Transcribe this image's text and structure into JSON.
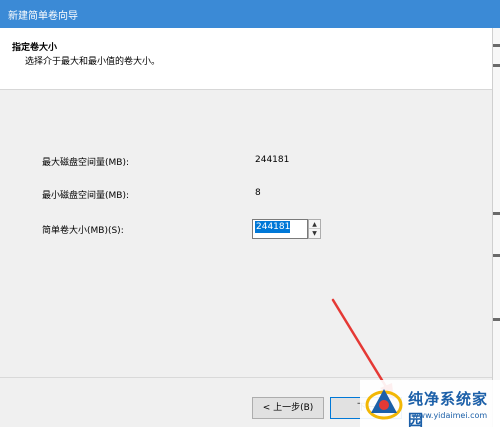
{
  "window": {
    "title": "新建简单卷向导"
  },
  "header": {
    "title": "指定卷大小",
    "subtitle": "选择介于最大和最小值的卷大小。"
  },
  "fields": [
    {
      "label": "最大磁盘空间量(MB):",
      "value": "244181"
    },
    {
      "label": "最小磁盘空间量(MB):",
      "value": "8"
    }
  ],
  "size_field": {
    "label": "简单卷大小(MB)(S):",
    "value": "244181"
  },
  "buttons": {
    "back": "< 上一步(B)",
    "next": "下一"
  },
  "watermark": {
    "title": "纯净系统家园",
    "url": "www.yidaimei.com"
  },
  "colors": {
    "titlebar": "#3b8ad6",
    "selection": "#0078d7",
    "annotation_arrow": "#e53935",
    "watermark_text": "#1b5fa8"
  },
  "icons": [
    "spin-up-icon",
    "spin-down-icon",
    "annotation-arrow-icon",
    "watermark-logo-icon"
  ]
}
